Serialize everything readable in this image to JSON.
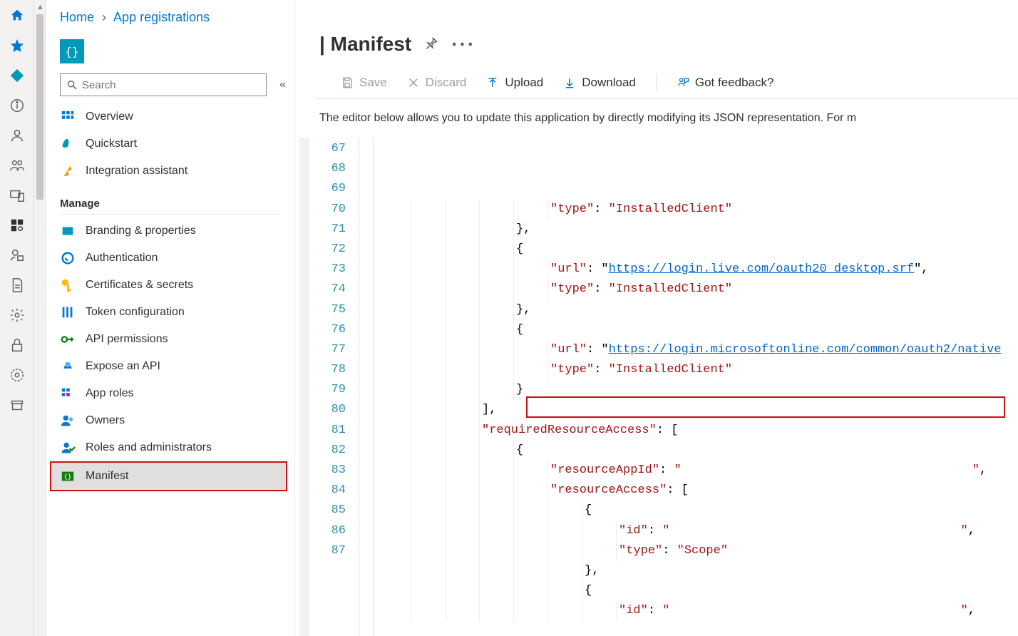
{
  "breadcrumb": {
    "home": "Home",
    "page": "App registrations"
  },
  "app_icon_text": "{}",
  "search": {
    "placeholder": "Search"
  },
  "page_title": "| Manifest",
  "nav": {
    "overview": "Overview",
    "quickstart": "Quickstart",
    "integration": "Integration assistant",
    "manage_label": "Manage",
    "branding": "Branding & properties",
    "authentication": "Authentication",
    "certs": "Certificates & secrets",
    "token": "Token configuration",
    "api_perm": "API permissions",
    "expose": "Expose an API",
    "app_roles": "App roles",
    "owners": "Owners",
    "roles_admin": "Roles and administrators",
    "manifest": "Manifest"
  },
  "toolbar": {
    "save": "Save",
    "discard": "Discard",
    "upload": "Upload",
    "download": "Download",
    "feedback": "Got feedback?"
  },
  "desc": "The editor below allows you to update this application by directly modifying its JSON representation. For m",
  "code": {
    "first_line_no": 67,
    "lines": [
      {
        "indent": 5,
        "tokens": [
          [
            "k-str",
            "\"type\""
          ],
          [
            "k-punct",
            ": "
          ],
          [
            "k-str",
            "\"InstalledClient\""
          ]
        ]
      },
      {
        "indent": 4,
        "tokens": [
          [
            "k-punct",
            "},"
          ]
        ]
      },
      {
        "indent": 4,
        "tokens": [
          [
            "k-punct",
            "{"
          ]
        ]
      },
      {
        "indent": 5,
        "tokens": [
          [
            "k-str",
            "\"url\""
          ],
          [
            "k-punct",
            ": \""
          ],
          [
            "k-link",
            "https://login.live.com/oauth20_desktop.srf"
          ],
          [
            "k-punct",
            "\","
          ]
        ]
      },
      {
        "indent": 5,
        "tokens": [
          [
            "k-str",
            "\"type\""
          ],
          [
            "k-punct",
            ": "
          ],
          [
            "k-str",
            "\"InstalledClient\""
          ]
        ]
      },
      {
        "indent": 4,
        "tokens": [
          [
            "k-punct",
            "},"
          ]
        ]
      },
      {
        "indent": 4,
        "tokens": [
          [
            "k-punct",
            "{"
          ]
        ]
      },
      {
        "indent": 5,
        "tokens": [
          [
            "k-str",
            "\"url\""
          ],
          [
            "k-punct",
            ": \""
          ],
          [
            "k-link",
            "https://login.microsoftonline.com/common/oauth2/native"
          ]
        ]
      },
      {
        "indent": 5,
        "tokens": [
          [
            "k-str",
            "\"type\""
          ],
          [
            "k-punct",
            ": "
          ],
          [
            "k-str",
            "\"InstalledClient\""
          ]
        ]
      },
      {
        "indent": 4,
        "tokens": [
          [
            "k-punct",
            "}"
          ]
        ]
      },
      {
        "indent": 3,
        "tokens": [
          [
            "k-punct",
            "],"
          ]
        ]
      },
      {
        "indent": 3,
        "tokens": [
          [
            "k-str",
            "\"requiredResourceAccess\""
          ],
          [
            "k-punct",
            ": ["
          ]
        ]
      },
      {
        "indent": 4,
        "tokens": [
          [
            "k-punct",
            "{"
          ]
        ]
      },
      {
        "indent": 5,
        "tokens": [
          [
            "k-str",
            "\"resourceAppId\""
          ],
          [
            "k-punct",
            ": "
          ],
          [
            "k-str",
            "\"                                        \""
          ],
          [
            "k-punct",
            ","
          ]
        ]
      },
      {
        "indent": 5,
        "tokens": [
          [
            "k-str",
            "\"resourceAccess\""
          ],
          [
            "k-punct",
            ": ["
          ]
        ]
      },
      {
        "indent": 6,
        "tokens": [
          [
            "k-punct",
            "{"
          ]
        ]
      },
      {
        "indent": 7,
        "tokens": [
          [
            "k-str",
            "\"id\""
          ],
          [
            "k-punct",
            ": "
          ],
          [
            "k-str",
            "\"                                        \""
          ],
          [
            "k-punct",
            ","
          ]
        ]
      },
      {
        "indent": 7,
        "tokens": [
          [
            "k-str",
            "\"type\""
          ],
          [
            "k-punct",
            ": "
          ],
          [
            "k-str",
            "\"Scope\""
          ]
        ]
      },
      {
        "indent": 6,
        "tokens": [
          [
            "k-punct",
            "},"
          ]
        ]
      },
      {
        "indent": 6,
        "tokens": [
          [
            "k-punct",
            "{"
          ]
        ]
      },
      {
        "indent": 7,
        "tokens": [
          [
            "k-str",
            "\"id\""
          ],
          [
            "k-punct",
            ": "
          ],
          [
            "k-str",
            "\"                                        \""
          ],
          [
            "k-punct",
            ","
          ]
        ]
      }
    ]
  }
}
